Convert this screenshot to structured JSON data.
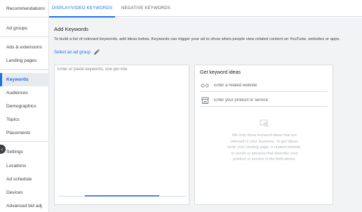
{
  "sidebar": {
    "items": [
      {
        "label": "Recommendations",
        "active": false
      },
      {
        "label": "Ad groups",
        "active": false
      },
      {
        "label": "Ads & extensions",
        "active": false
      },
      {
        "label": "Landing pages",
        "active": false
      },
      {
        "label": "Keywords",
        "active": true
      },
      {
        "label": "Audiences",
        "active": false
      },
      {
        "label": "Demographics",
        "active": false
      },
      {
        "label": "Topics",
        "active": false
      },
      {
        "label": "Placements",
        "active": false
      },
      {
        "label": "Settings",
        "active": false
      },
      {
        "label": "Locations",
        "active": false
      },
      {
        "label": "Ad schedule",
        "active": false
      },
      {
        "label": "Devices",
        "active": false
      },
      {
        "label": "Advanced bid adj.",
        "active": false
      }
    ],
    "collapse_icon": "chevron-left-icon"
  },
  "tabs": [
    {
      "label": "DISPLAY/VIDEO KEYWORDS",
      "active": true
    },
    {
      "label": "NEGATIVE KEYWORDS",
      "active": false
    }
  ],
  "main": {
    "title": "Add Keywords",
    "description": "To build a list of relevant keywords, add ideas below. Keywords can trigger your ad to show when people view related content on YouTube, websites or apps.",
    "select_group_label": "Select an ad group",
    "select_group_icon": "pencil-icon",
    "keywords_placeholder": "Enter or paste keywords, one per line"
  },
  "ideas": {
    "title": "Get keyword ideas",
    "website_placeholder": "Enter a related website",
    "website_icon": "link-icon",
    "product_placeholder": "Enter your product or service",
    "product_icon": "store-icon",
    "empty_icon": "no-results-icon",
    "empty_text": "We only show keyword ideas that are relevant to your business. To get ideas, enter your landing page, a related website, or words or phrases that describe your product or service in the field above."
  },
  "colors": {
    "accent": "#1a73e8",
    "background": "#f1f3f4",
    "divider": "#dadce0"
  }
}
